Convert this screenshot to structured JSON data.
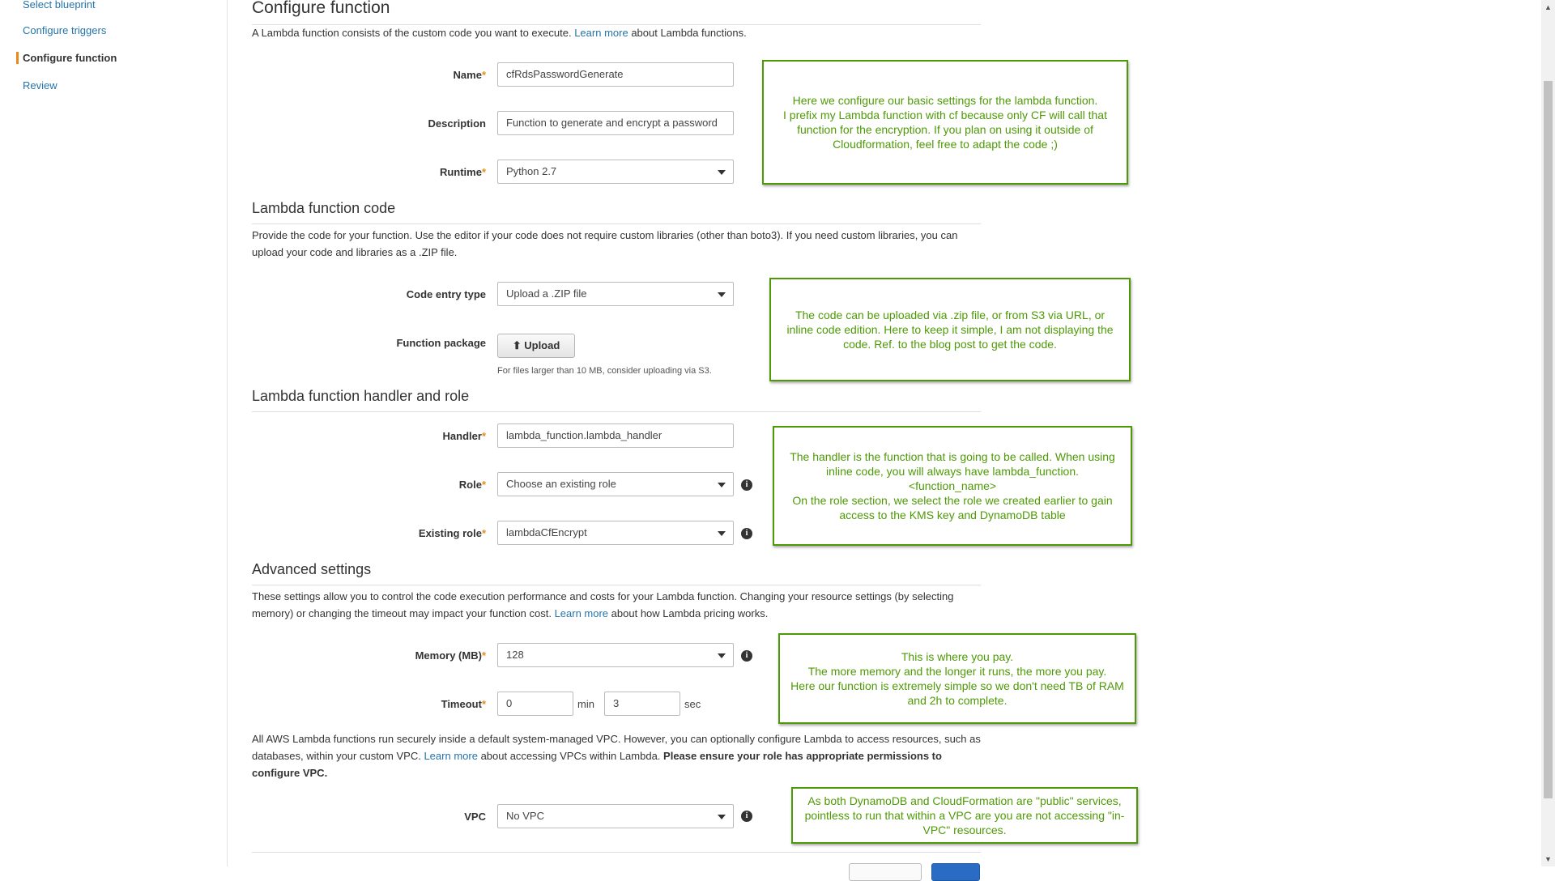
{
  "sidebar": {
    "items": [
      {
        "label": "Select blueprint",
        "active": false
      },
      {
        "label": "Configure triggers",
        "active": false
      },
      {
        "label": "Configure function",
        "active": true
      },
      {
        "label": "Review",
        "active": false
      }
    ]
  },
  "configure": {
    "title": "Configure function",
    "desc_pre": "A Lambda function consists of the custom code you want to execute.",
    "desc_link": "Learn more",
    "desc_post": "about Lambda functions.",
    "name_label": "Name",
    "name_value": "cfRdsPasswordGenerate",
    "description_label": "Description",
    "description_value": "Function to generate and encrypt a password",
    "runtime_label": "Runtime",
    "runtime_value": "Python 2.7"
  },
  "code": {
    "title": "Lambda function code",
    "desc": "Provide the code for your function. Use the editor if your code does not require custom libraries (other than boto3). If you need custom libraries, you can upload your code and libraries as a .ZIP file.",
    "entry_label": "Code entry type",
    "entry_value": "Upload a .ZIP file",
    "package_label": "Function package",
    "upload_label": "Upload",
    "hint": "For files larger than 10 MB, consider uploading via S3."
  },
  "handler": {
    "title": "Lambda function handler and role",
    "handler_label": "Handler",
    "handler_value": "lambda_function.lambda_handler",
    "role_label": "Role",
    "role_value": "Choose an existing role",
    "existing_label": "Existing role",
    "existing_value": "lambdaCfEncrypt"
  },
  "advanced": {
    "title": "Advanced settings",
    "desc_pre": "These settings allow you to control the code execution performance and costs for your Lambda function. Changing your resource settings (by selecting memory) or changing the timeout may impact your function cost.",
    "desc_link": "Learn more",
    "desc_post": "about how Lambda pricing works.",
    "memory_label": "Memory (MB)",
    "memory_value": "128",
    "timeout_label": "Timeout",
    "timeout_min": "0",
    "min_unit": "min",
    "timeout_sec": "3",
    "sec_unit": "sec",
    "vpc_desc_pre": "All AWS Lambda functions run securely inside a default system-managed VPC. However, you can optionally configure Lambda to access resources, such as databases, within your custom VPC.",
    "vpc_desc_link": "Learn more",
    "vpc_desc_mid": "about accessing VPCs within Lambda.",
    "vpc_desc_bold": "Please ensure your role has appropriate permissions to configure VPC.",
    "vpc_label": "VPC",
    "vpc_value": "No VPC"
  },
  "required_mark": "*",
  "info_glyph": "i",
  "notes": {
    "note1": "Here we configure our basic settings for the lambda function.\nI prefix my Lambda function with cf because only CF will call that function for the encryption. If you plan on using it outside of Cloudformation, feel free to adapt the code ;)",
    "note2": "The code can be uploaded via .zip file, or from S3 via URL, or inline code edition. Here to keep it simple, I am not displaying the code. Ref. to the blog post to get the code.",
    "note3": "The handler is the function that is going to be called. When using inline code, you will always have lambda_function.<function_name>\nOn the role section, we select the role we created earlier to gain access to the KMS key and DynamoDB table",
    "note4": "This is where you pay.\nThe more memory and the longer it runs, the more you pay.\nHere our function is extremely simple so we don't need TB of RAM and 2h to complete.",
    "note5": "As both DynamoDB and CloudFormation are \"public\" services, pointless to run that within a VPC are you are not accessing \"in-VPC\" resources."
  },
  "colors": {
    "accent": "#e88a1a",
    "link": "#2574a9",
    "note_green": "#4e9a06"
  }
}
